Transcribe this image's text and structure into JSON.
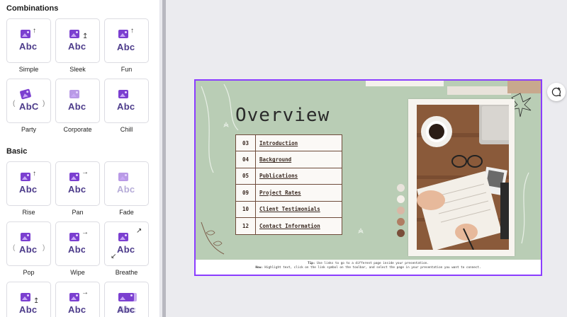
{
  "panel": {
    "combinations_title": "Combinations",
    "basic_title": "Basic",
    "combinations": [
      {
        "label": "Simple"
      },
      {
        "label": "Sleek"
      },
      {
        "label": "Fun"
      },
      {
        "label": "Party"
      },
      {
        "label": "Corporate"
      },
      {
        "label": "Chill"
      }
    ],
    "basic": [
      {
        "label": "Rise"
      },
      {
        "label": "Pan"
      },
      {
        "label": "Fade"
      },
      {
        "label": "Pop"
      },
      {
        "label": "Wipe"
      },
      {
        "label": "Breathe"
      },
      {
        "label": ""
      },
      {
        "label": ""
      },
      {
        "label": ""
      }
    ],
    "sample_text": "Abc",
    "sample_text_party": "AbC"
  },
  "slide": {
    "title": "Overview",
    "agenda": [
      {
        "num": "03",
        "topic": "Introduction"
      },
      {
        "num": "04",
        "topic": "Background"
      },
      {
        "num": "05",
        "topic": "Publications"
      },
      {
        "num": "09",
        "topic": "Project Rates"
      },
      {
        "num": "10",
        "topic": "Client Testimonials"
      },
      {
        "num": "12",
        "topic": "Contact Information"
      }
    ],
    "swatches": [
      "#e9e3dc",
      "#f4efe9",
      "#d9b7a5",
      "#b07d63",
      "#7a4e3a"
    ],
    "footer_tip_label": "Tip:",
    "footer_tip": "Use links to go to a different page inside your presentation.",
    "footer_how_label": "How:",
    "footer_how": "Highlight text, click on the link symbol on the toolbar, and select the page in your presentation you want to connect."
  },
  "colors": {
    "accent": "#8b3dff",
    "slide_green": "#b9cdb5",
    "table_border": "#6e4b3a"
  },
  "icons": {
    "comment": "add-comment-icon",
    "tile_image": "image-icon"
  }
}
